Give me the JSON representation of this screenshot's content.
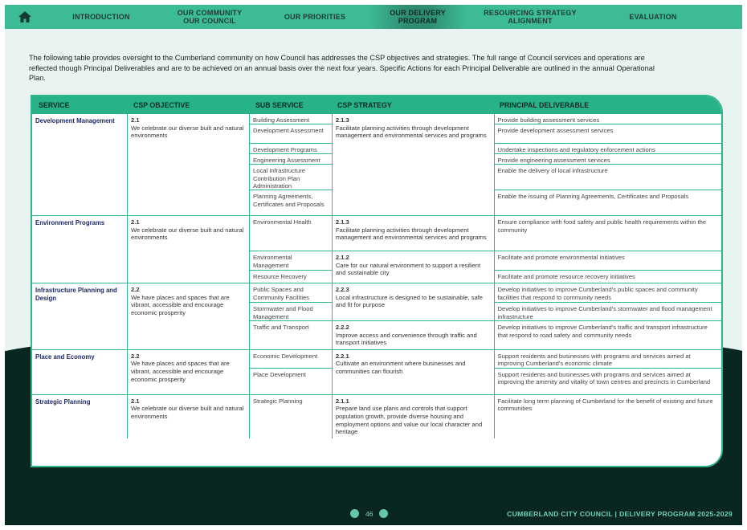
{
  "nav": {
    "items": [
      {
        "label": "INTRODUCTION"
      },
      {
        "label": "OUR COMMUNITY\nOUR COUNCIL"
      },
      {
        "label": "OUR PRIORITIES"
      },
      {
        "label": "OUR DELIVERY\nPROGRAM"
      },
      {
        "label": "RESOURCING STRATEGY\nALIGNMENT"
      },
      {
        "label": "EVALUATION"
      }
    ],
    "active_index": 3,
    "home_icon": "home-icon"
  },
  "intro": "The following table provides oversight to the Cumberland community on how Council has addresses the CSP objectives and strategies. The full range of Council services and operations are reflected though Principal Deliverables and are to be achieved on an annual basis over the next four years. Specific Actions for each Principal Deliverable are outlined in the annual Operational Plan.",
  "table": {
    "headers": [
      "SERVICE",
      "CSP OBJECTIVE",
      "SUB SERVICE",
      "CSP STRATEGY",
      "PRINCIPAL DELIVERABLE"
    ],
    "services": [
      {
        "service": "Development Management",
        "objective_num": "2.1",
        "objective": "We celebrate our diverse built and natural environments",
        "strategies": [
          {
            "num": "2.1.3",
            "text": "Facilitate planning activities through development management and environmental services and programs",
            "rows": [
              {
                "sub": "Building Assessment",
                "deliverable": "Provide building assessment services"
              },
              {
                "sub": "Development Assessment",
                "deliverable": "Provide development assessment services"
              },
              {
                "sub": "Development Programs",
                "deliverable": "Undertake inspections and regulatory enforcement actions"
              },
              {
                "sub": "Engineering Assessment",
                "deliverable": "Provide engineering assessment services"
              },
              {
                "sub": "Local Infrastructure Contribution Plan Administration",
                "deliverable": "Enable the delivery of local infrastructure"
              },
              {
                "sub": "Planning Agreements, Certificates and Proposals",
                "deliverable": "Enable the issuing of Planning Agreements, Certificates and Proposals"
              }
            ]
          }
        ]
      },
      {
        "service": "Environment Programs",
        "objective_num": "2.1",
        "objective": "We celebrate our diverse built and natural environments",
        "strategies": [
          {
            "num": "2.1.3",
            "text": "Facilitate planning activities through development management and environmental services and programs",
            "rows": [
              {
                "sub": "Environmental Health",
                "deliverable": "Ensure compliance with food safety and public health requirements within the community"
              }
            ]
          },
          {
            "num": "2.1.2",
            "text": "Care for our natural environment to support a resilient and sustainable city",
            "rows": [
              {
                "sub": "Environmental Management",
                "deliverable": "Facilitate and promote environmental initiatives"
              },
              {
                "sub": "Resource Recovery",
                "deliverable": "Facilitate and promote resource recovery initiatives"
              }
            ]
          }
        ]
      },
      {
        "service": "Infrastructure Planning and Design",
        "objective_num": "2.2",
        "objective": "We have places and spaces that are vibrant, accessible and encourage economic prosperity",
        "strategies": [
          {
            "num": "2.2.3",
            "text": "Local infrastructure is designed to be sustainable, safe and fit for purpose",
            "rows": [
              {
                "sub": "Public Spaces and Community Facilities",
                "deliverable": "Develop initiatives to improve Cumberland's public spaces and community facilities that respond to community needs"
              },
              {
                "sub": "Stormwater and Flood Management",
                "deliverable": "Develop initiatives to improve Cumberland's stormwater and flood management infrastructure"
              }
            ]
          },
          {
            "num": "2.2.2",
            "text": "Improve access and convenience through traffic and transport initiatives",
            "rows": [
              {
                "sub": "Traffic and Transport",
                "deliverable": "Develop initiatives to improve Cumberland's traffic and transport infrastructure that respond to road safety and community needs"
              }
            ]
          }
        ]
      },
      {
        "service": "Place and Economy",
        "objective_num": "2.2",
        "objective": "We have places and spaces that are vibrant, accessible and encourage economic prosperity",
        "strategies": [
          {
            "num": "2.2.1",
            "text": "Cultivate an environment where businesses and communities can flourish",
            "rows": [
              {
                "sub": "Economic Development",
                "deliverable": "Support residents and businesses with programs and services aimed at improving Cumberland's economic climate"
              },
              {
                "sub": "Place Development",
                "deliverable": "Support residents and businesses with programs and services aimed at improving the amenity and vitality of town centres and precincts in Cumberland"
              }
            ]
          }
        ]
      },
      {
        "service": "Strategic Planning",
        "objective_num": "2.1",
        "objective": "We celebrate our diverse built and natural environments",
        "strategies": [
          {
            "num": "2.1.1",
            "text": "Prepare land use plans and controls that support population growth, provide diverse housing and employment options and value our local character and heritage",
            "rows": [
              {
                "sub": "Strategic Planning",
                "deliverable": "Facilitate long term planning of Cumberland for the benefit of existing and future communities"
              }
            ]
          }
        ]
      }
    ]
  },
  "footer": {
    "page": "46",
    "org": "CUMBERLAND CITY COUNCIL",
    "separator": "|",
    "doc": "DELIVERY PROGRAM 2025-2029"
  },
  "colors": {
    "accent": "#3dbb97",
    "dark": "#0a2620",
    "service_text": "#1e2a66"
  }
}
